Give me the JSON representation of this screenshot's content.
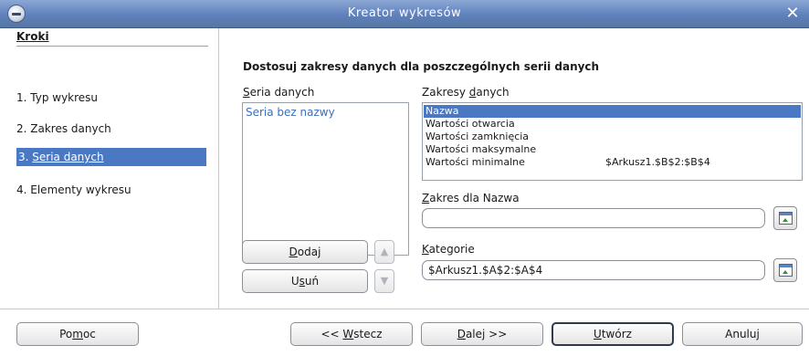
{
  "window": {
    "title": "Kreator wykresów"
  },
  "steps": {
    "heading": "Kroki",
    "items": [
      {
        "label": "1. Typ wykresu"
      },
      {
        "label": "2. Zakres danych"
      },
      {
        "num": "3. ",
        "label": "Seria danych"
      },
      {
        "label": "4. Elementy wykresu"
      }
    ]
  },
  "main": {
    "heading": "Dostosuj zakresy danych dla poszczególnych serii danych",
    "series": {
      "label_prefix": "",
      "label_u": "S",
      "label_rest": "eria danych",
      "items": [
        "Seria bez nazwy"
      ]
    },
    "ranges": {
      "label_pre": "Zakresy ",
      "label_u": "d",
      "label_rest": "anych",
      "rows": [
        {
          "name": "Nazwa",
          "value": ""
        },
        {
          "name": "Wartości otwarcia",
          "value": ""
        },
        {
          "name": "Wartości zamknięcia",
          "value": ""
        },
        {
          "name": "Wartości maksymalne",
          "value": ""
        },
        {
          "name": "Wartości minimalne",
          "value": "$Arkusz1.$B$2:$B$4"
        }
      ]
    },
    "range_for": {
      "label_u": "Z",
      "label_rest": "akres dla Nazwa",
      "value": ""
    },
    "categories": {
      "label_u": "K",
      "label_rest": "ategorie",
      "value": "$Arkusz1.$A$2:$A$4"
    },
    "add_button": {
      "u": "D",
      "rest": "odaj"
    },
    "remove_button": {
      "pre": "U",
      "u": "s",
      "rest": "uń"
    },
    "up_arrow": "▲",
    "down_arrow": "▼"
  },
  "footer": {
    "help": {
      "pre": "Po",
      "u": "m",
      "rest": "oc"
    },
    "back": {
      "pre": "<< ",
      "u": "W",
      "rest": "stecz"
    },
    "next": {
      "pre": "",
      "u": "D",
      "rest": "alej >>"
    },
    "finish": {
      "pre": "",
      "u": "U",
      "rest": "twórz"
    },
    "cancel": {
      "label": "Anuluj"
    }
  },
  "colors": {
    "selection": "#4a78c3",
    "titlebar": "#6a8cc8"
  }
}
